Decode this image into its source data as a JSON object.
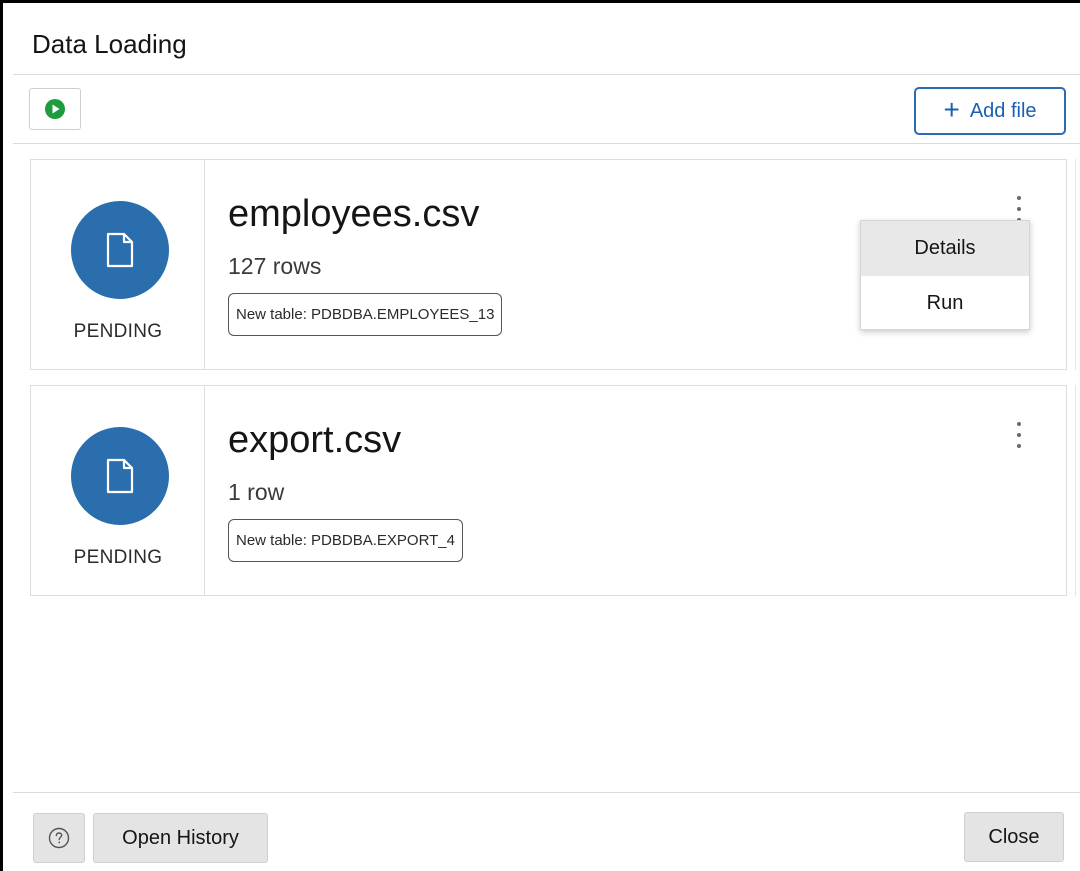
{
  "window": {
    "title": "Data Loading"
  },
  "toolbar": {
    "run_icon": "play-circle-icon",
    "add_file_label": "Add file",
    "add_file_icon": "plus-icon"
  },
  "files": [
    {
      "name": "employees.csv",
      "rows": "127 rows",
      "table": "New table: PDBDBA.EMPLOYEES_13",
      "status": "PENDING",
      "icon": "file-icon"
    },
    {
      "name": "export.csv",
      "rows": "1 row",
      "table": "New table: PDBDBA.EXPORT_4",
      "status": "PENDING",
      "icon": "file-icon"
    }
  ],
  "context_menu": {
    "items": [
      "Details",
      "Run"
    ],
    "highlighted": "Details"
  },
  "footer": {
    "help_icon": "help-icon",
    "open_history_label": "Open History",
    "close_label": "Close"
  },
  "colors": {
    "accent": "#2a6bb5",
    "file_circle": "#2a6ead",
    "run_green": "#1e9b3c"
  }
}
